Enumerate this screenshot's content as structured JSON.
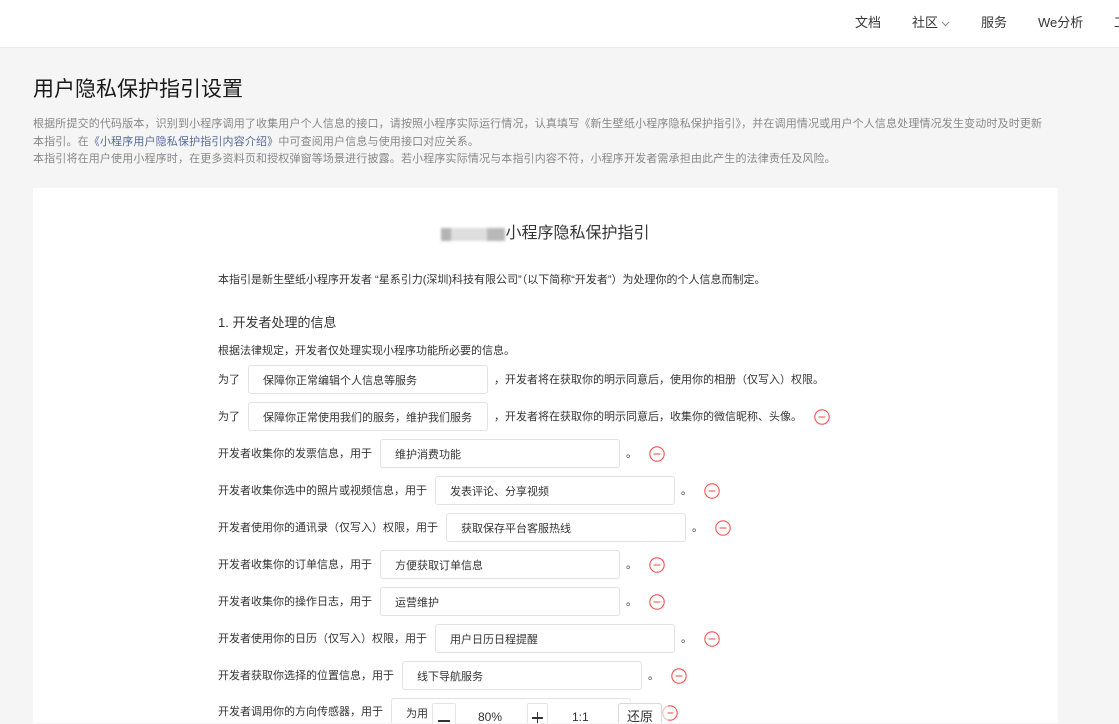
{
  "topnav": {
    "items": [
      {
        "label": "文档"
      },
      {
        "label": "社区",
        "icon": "chevron-down-icon"
      },
      {
        "label": "服务"
      },
      {
        "label": "We分析"
      },
      {
        "label": "工"
      }
    ]
  },
  "page": {
    "title": "用户隐私保护指引设置",
    "description": {
      "line1": "根据所提交的代码版本，识别到小程序调用了收集用户个人信息的接口，请按照小程序实际运行情况，认真填写《新生壁纸小程序隐私保护指引》，并在调用情况或用户个人信息处理情况发生变动时及时更新",
      "line2_before_link": "本指引。在",
      "link": "《小程序用户隐私保护指引内容介绍》",
      "line2_after_link": "中可查阅用户信息与使用接口对应关系。",
      "line3": "本指引将在用户使用小程序时，在更多资料页和授权弹窗等场景进行披露。若小程序实际情况与本指引内容不符，小程序开发者需承担由此产生的法律责任及风险。"
    }
  },
  "guide": {
    "title": "小程序隐私保护指引",
    "intro": "本指引是新生壁纸小程序开发者 “星系引力(深圳)科技有限公司”（以下简称“开发者”）为处理你的个人信息而制定。",
    "section_1": {
      "heading": "1. 开发者处理的信息",
      "note": "根据法律规定，开发者仅处理实现小程序功能所必要的信息。",
      "rows": [
        {
          "before": "为了",
          "value": "保障你正常编辑个人信息等服务",
          "after": "，开发者将在获取你的明示同意后，使用你的相册（仅写入）权限。"
        },
        {
          "before": "为了",
          "value": "保障你正常使用我们的服务，维护我们服务",
          "after": "，开发者将在获取你的明示同意后，收集你的微信昵称、头像。",
          "remove_icon": "minus-circle-icon"
        },
        {
          "before": "开发者收集你的发票信息，用于",
          "value": "维护消费功能",
          "after": "。",
          "remove_icon": "minus-circle-icon"
        },
        {
          "before": "开发者收集你选中的照片或视频信息，用于",
          "value": "发表评论、分享视频",
          "after": "。",
          "remove_icon": "minus-circle-icon"
        },
        {
          "before": "开发者使用你的通讯录（仅写入）权限，用于",
          "value": "获取保存平台客服热线",
          "after": "。",
          "remove_icon": "minus-circle-icon"
        },
        {
          "before": "开发者收集你的订单信息，用于",
          "value": "方便获取订单信息",
          "after": "。",
          "remove_icon": "minus-circle-icon"
        },
        {
          "before": "开发者收集你的操作日志，用于",
          "value": "运营维护",
          "after": "。",
          "remove_icon": "minus-circle-icon"
        },
        {
          "before": "开发者使用你的日历（仅写入）权限，用于",
          "value": "用户日历日程提醒",
          "after": "。",
          "remove_icon": "minus-circle-icon"
        },
        {
          "before": "开发者获取你选择的位置信息，用于",
          "value": "线下导航服务",
          "after": "。",
          "remove_icon": "minus-circle-icon"
        },
        {
          "before": "开发者调用你的方向传感器，用于",
          "value": "为用",
          "remove_icon": "minus-circle-icon"
        }
      ]
    }
  },
  "image_viewer_toolbar": {
    "zoom_out_icon": "minus-icon",
    "zoom_level": "80%",
    "zoom_in_icon": "plus-icon",
    "actual_size_label": "1:1",
    "reset_label": "还原"
  },
  "colors": {
    "page_background": "#f5f5f5",
    "link": "#576b95",
    "remove_icon": "#fa5151",
    "text": "#353535",
    "muted_text": "#888888"
  }
}
